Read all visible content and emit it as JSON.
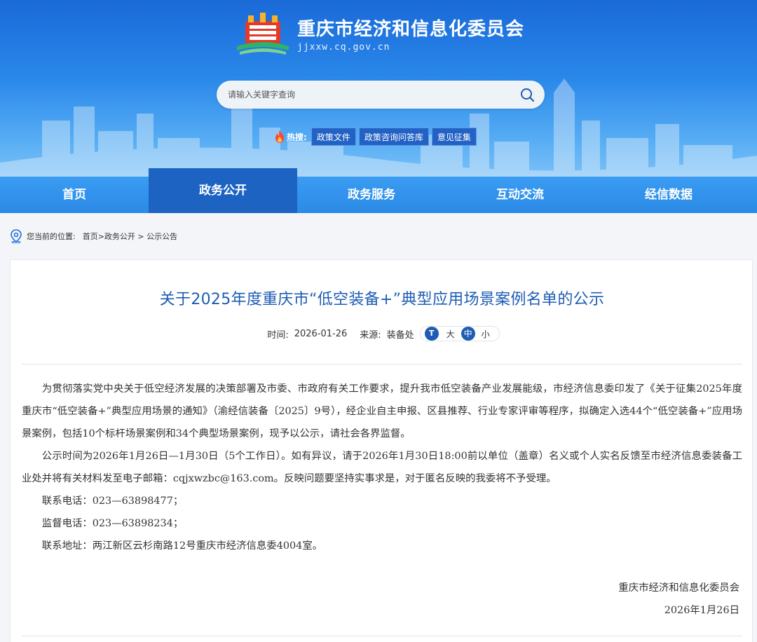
{
  "site": {
    "title": "重庆市经济和信息化委员会",
    "domain": "jjxxw.cq.gov.cn"
  },
  "search": {
    "placeholder": "请输入关键字查询"
  },
  "hot": {
    "label": "热搜:",
    "tags": [
      "政策文件",
      "政策咨询问答库",
      "意见征集"
    ]
  },
  "nav": {
    "items": [
      "首页",
      "政务公开",
      "政务服务",
      "互动交流",
      "经信数据"
    ],
    "active_index": 1
  },
  "breadcrumb": {
    "label": "您当前的位置:",
    "path": "首页>政务公开 > 公示公告"
  },
  "article": {
    "title": "关于2025年度重庆市“低空装备+”典型应用场景案例名单的公示",
    "time_label": "时间:",
    "time": "2026-01-26",
    "source_label": "来源:",
    "source": "装备处",
    "font_sizes": {
      "icon": "T",
      "large": "大",
      "medium": "中",
      "small": "小"
    },
    "paragraphs": [
      "为贯彻落实党中央关于低空经济发展的决策部署及市委、市政府有关工作要求，提升我市低空装备产业发展能级，市经济信息委印发了《关于征集2025年度重庆市“低空装备+”典型应用场景的通知》（渝经信装备〔2025〕9号），经企业自主申报、区县推荐、行业专家评审等程序，拟确定入选44个“低空装备+”应用场景案例，包括10个标杆场景案例和34个典型场景案例，现予以公示，请社会各界监督。",
      "公示时间为2026年1月26日—1月30日（5个工作日）。如有异议，请于2026年1月30日18:00前以单位（盖章）名义或个人实名反馈至市经济信息委装备工业处并将有关材料发至电子邮箱：cqjxwzbc@163.com。反映问题要坚持实事求是，对于匿名反映的我委将不予受理。",
      "联系电话：023—63898477；",
      "监督电话：023—63898234；",
      "联系地址：两江新区云杉南路12号重庆市经济信息委4004室。"
    ],
    "signature": "重庆市经济和信息化委员会",
    "date": "2026年1月26日"
  }
}
